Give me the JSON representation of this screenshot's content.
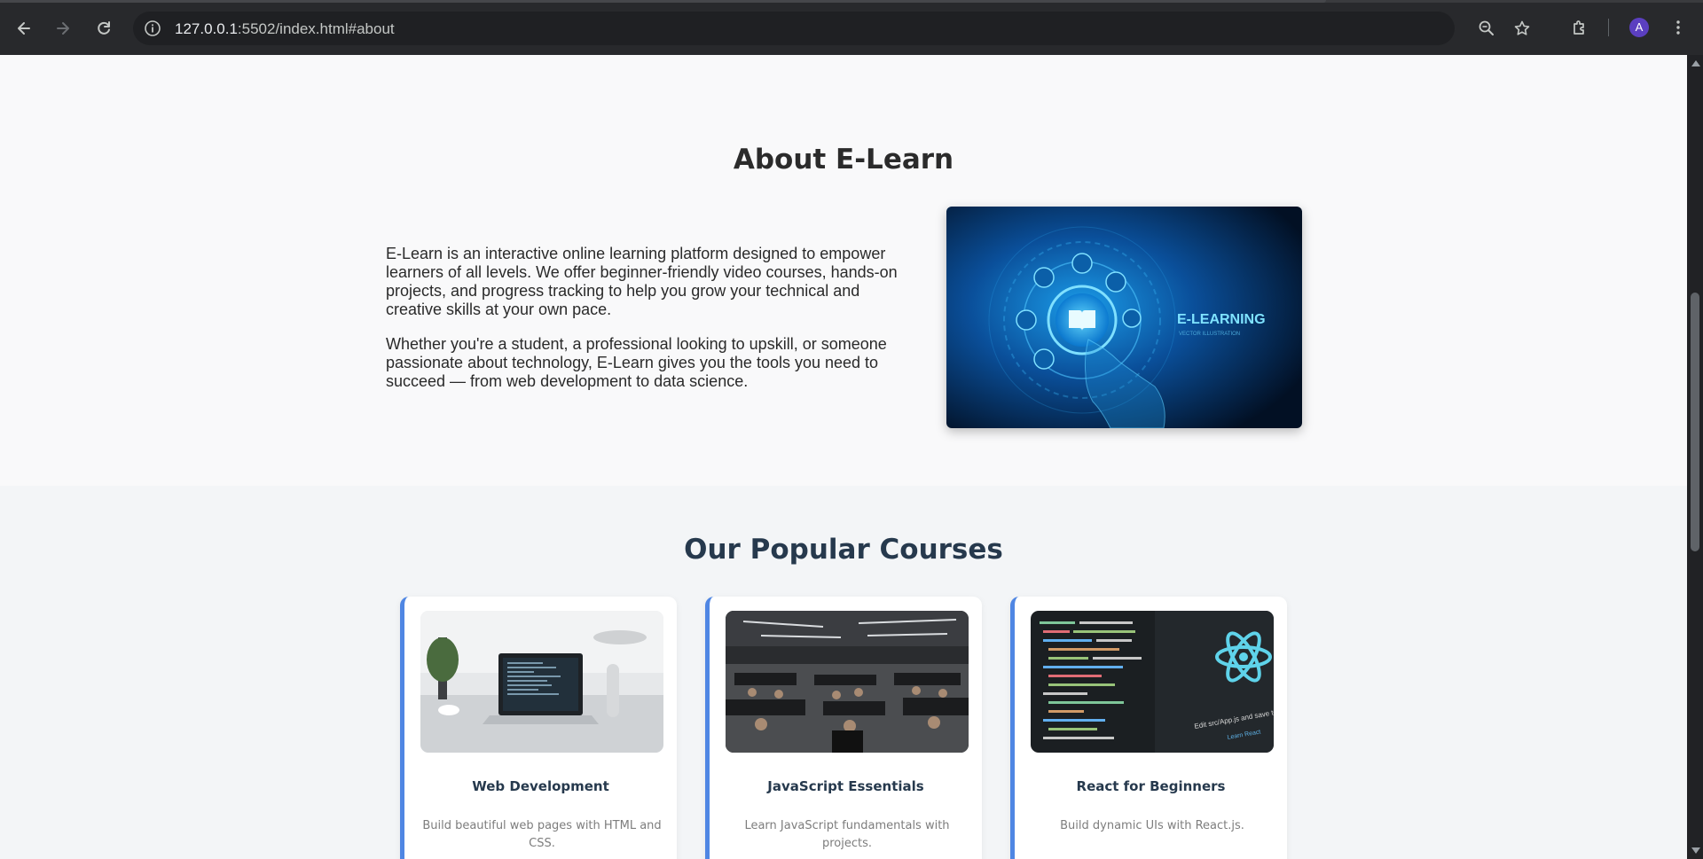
{
  "browser": {
    "url_host": "127.0.0.1",
    "url_path": ":5502/index.html#about",
    "avatar_letter": "A",
    "icons": [
      "back-icon",
      "forward-icon",
      "reload-icon",
      "site-info-icon",
      "zoom-icon",
      "bookmark-star-icon",
      "extensions-icon",
      "menu-icon"
    ]
  },
  "about": {
    "title": "About E-Learn",
    "paragraph1": "E-Learn is an interactive online learning platform designed to empower learners of all levels. We offer beginner-friendly video courses, hands-on projects, and progress tracking to help you grow your technical and creative skills at your own pace.",
    "paragraph2": "Whether you're a student, a professional looking to upskill, or someone passionate about technology, E-Learn gives you the tools you need to succeed — from web development to data science.",
    "image_title": "E-LEARNING",
    "image_subtitle": "VECTOR ILLUSTRATION"
  },
  "courses": {
    "title": "Our Popular Courses",
    "items": [
      {
        "title": "Web Development",
        "description": "Build beautiful web pages with HTML and CSS."
      },
      {
        "title": "JavaScript Essentials",
        "description": "Learn JavaScript fundamentals with projects."
      },
      {
        "title": "React for Beginners",
        "description": "Build dynamic UIs with React.js.",
        "image_text": "Edit src/App.js and save to re",
        "image_link": "Learn React"
      }
    ]
  },
  "colors": {
    "accent": "#4f86e3",
    "heading": "#26394d",
    "chrome_bg": "#28292c"
  }
}
